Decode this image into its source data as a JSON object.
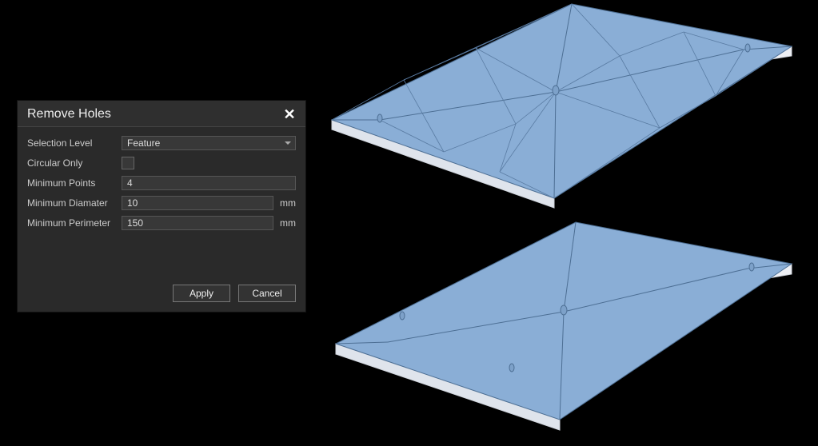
{
  "dialog": {
    "title": "Remove Holes",
    "fields": {
      "selection_level": {
        "label": "Selection Level",
        "value": "Feature"
      },
      "circular_only": {
        "label": "Circular Only",
        "checked": false
      },
      "min_points": {
        "label": "Minimum Points",
        "value": "4"
      },
      "min_diameter": {
        "label": "Minimum Diamater",
        "value": "10",
        "unit": "mm"
      },
      "min_perimeter": {
        "label": "Minimum Perimeter",
        "value": "150",
        "unit": "mm"
      }
    },
    "buttons": {
      "apply": "Apply",
      "cancel": "Cancel"
    }
  },
  "viewport": {
    "roof_face_color": "#8aaed6",
    "roof_edge_color": "#5a7ca3",
    "roof_side_color": "#e8ecf2",
    "background": "#000000"
  }
}
